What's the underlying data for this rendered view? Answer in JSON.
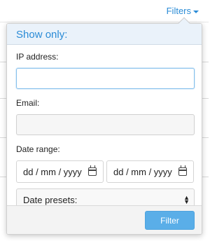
{
  "header": {
    "filters_label": "Filters"
  },
  "panel": {
    "title": "Show only:",
    "ip_label": "IP address:",
    "ip_value": "",
    "email_label": "Email:",
    "email_value": "",
    "date_label": "Date range:",
    "date_from_placeholder": "dd / mm / yyyy",
    "date_to_placeholder": "dd / mm / yyyy",
    "presets_label": "Date presets:",
    "submit_label": "Filter"
  },
  "colors": {
    "accent": "#2a8bd6",
    "button": "#5aaee8",
    "header_bg": "#eaf2fa"
  }
}
